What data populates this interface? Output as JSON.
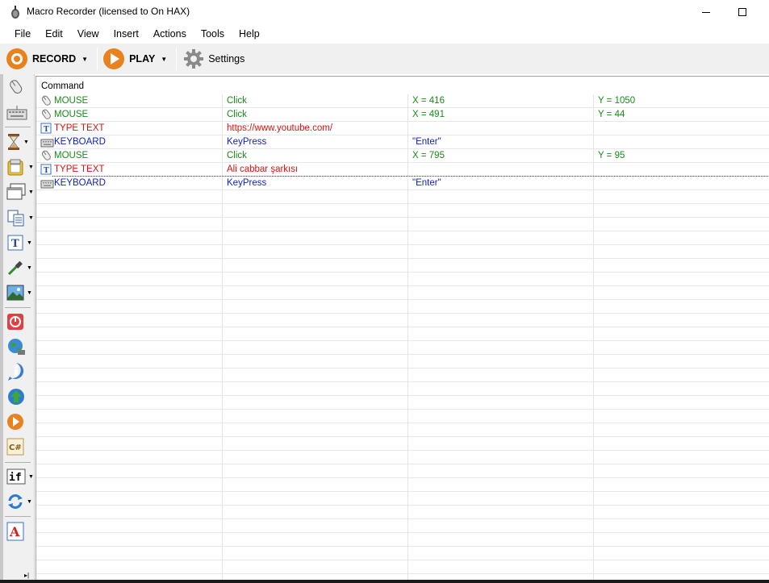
{
  "window": {
    "title": "Macro Recorder (licensed to On HAX)"
  },
  "menu": [
    "File",
    "Edit",
    "View",
    "Insert",
    "Actions",
    "Tools",
    "Help"
  ],
  "toolbar": {
    "record_label": "RECORD",
    "play_label": "PLAY",
    "settings_label": "Settings",
    "accent_color": "#e8821e"
  },
  "sidebar": {
    "icons": [
      "mouse-icon",
      "keyboard-icon",
      "hourglass-icon",
      "clipboard-icon",
      "window-icon",
      "copy-icon",
      "text-icon",
      "eyedropper-icon",
      "image-icon",
      "stop-icon",
      "globe-icon",
      "info-icon",
      "upload-icon",
      "play-macro-icon",
      "csharp-icon",
      "if-icon",
      "loop-icon",
      "font-icon"
    ]
  },
  "grid": {
    "header": "Command",
    "colors": {
      "mouse": "#1a8a1a",
      "type_text": "#e01010",
      "keyboard": "#1020c8"
    },
    "rows": [
      {
        "kind": "mouse",
        "icon": "mouse-icon",
        "command": "MOUSE",
        "c2": "Click",
        "c3": "X = 416",
        "c4": "Y = 1050"
      },
      {
        "kind": "mouse",
        "icon": "mouse-icon",
        "command": "MOUSE",
        "c2": "Click",
        "c3": "X = 491",
        "c4": "Y = 44"
      },
      {
        "kind": "type_text",
        "icon": "text-icon",
        "command": "TYPE TEXT",
        "c2": "https://www.youtube.com/",
        "c3": "",
        "c4": ""
      },
      {
        "kind": "keyboard",
        "icon": "keyboard-icon",
        "command": "KEYBOARD",
        "c2": "KeyPress",
        "c3": "\"Enter\"",
        "c4": ""
      },
      {
        "kind": "mouse",
        "icon": "mouse-icon",
        "command": "MOUSE",
        "c2": "Click",
        "c3": "X = 795",
        "c4": "Y = 95"
      },
      {
        "kind": "type_text",
        "icon": "text-icon",
        "command": "TYPE TEXT",
        "c2": "Ali cabbar şarkısı",
        "c3": "",
        "c4": ""
      },
      {
        "kind": "keyboard",
        "icon": "keyboard-icon",
        "command": "KEYBOARD",
        "c2": "KeyPress",
        "c3": "\"Enter\"",
        "c4": ""
      }
    ]
  }
}
